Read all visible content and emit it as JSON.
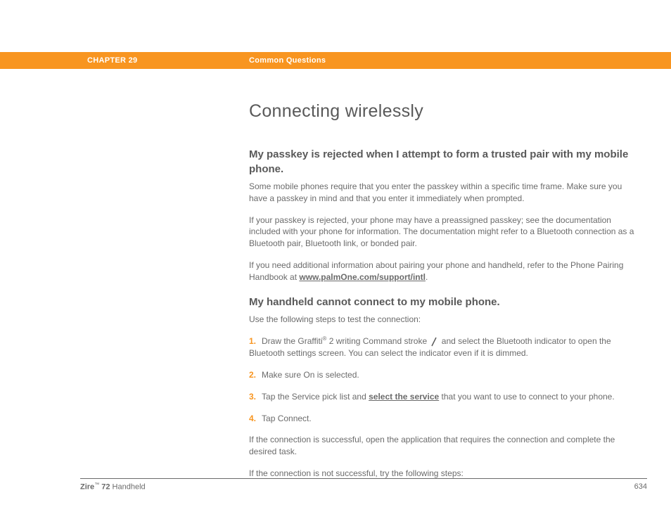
{
  "header": {
    "chapter": "CHAPTER 29",
    "section": "Common Questions"
  },
  "page_title": "Connecting wirelessly",
  "q1": {
    "title": "My passkey is rejected when I attempt to form a trusted pair with my mobile phone.",
    "p1": "Some mobile phones require that you enter the passkey within a specific time frame. Make sure you have a passkey in mind and that you enter it immediately when prompted.",
    "p2": "If your passkey is rejected, your phone may have a preassigned passkey; see the documentation included with your phone for information. The documentation might refer to a Bluetooth connection as a Bluetooth pair, Bluetooth link, or bonded pair.",
    "p3_before": "If you need additional information about pairing your phone and handheld, refer to the Phone Pairing Handbook at ",
    "p3_link": "www.palmOne.com/support/intl",
    "p3_after": "."
  },
  "q2": {
    "title": "My handheld cannot connect to my mobile phone.",
    "intro": "Use the following steps to test the connection:",
    "steps": {
      "n1": "1.",
      "s1_before": "Draw the Graffiti",
      "s1_reg": "®",
      "s1_mid": " 2 writing Command stroke ",
      "s1_after": " and select the Bluetooth indicator to open the Bluetooth settings screen. You can select the indicator even if it is dimmed.",
      "n2": "2.",
      "s2": "Make sure On is selected.",
      "n3": "3.",
      "s3_before": "Tap the Service pick list and ",
      "s3_link": "select the service",
      "s3_after": " that you want to use to connect to your phone.",
      "n4": "4.",
      "s4": "Tap Connect."
    },
    "p_success": "If the connection is successful, open the application that requires the connection and complete the desired task.",
    "p_fail": "If the connection is not successful, try the following steps:"
  },
  "footer": {
    "brand": "Zire",
    "tm": "™",
    "model": " 72 ",
    "device": "Handheld",
    "page_number": "634"
  }
}
